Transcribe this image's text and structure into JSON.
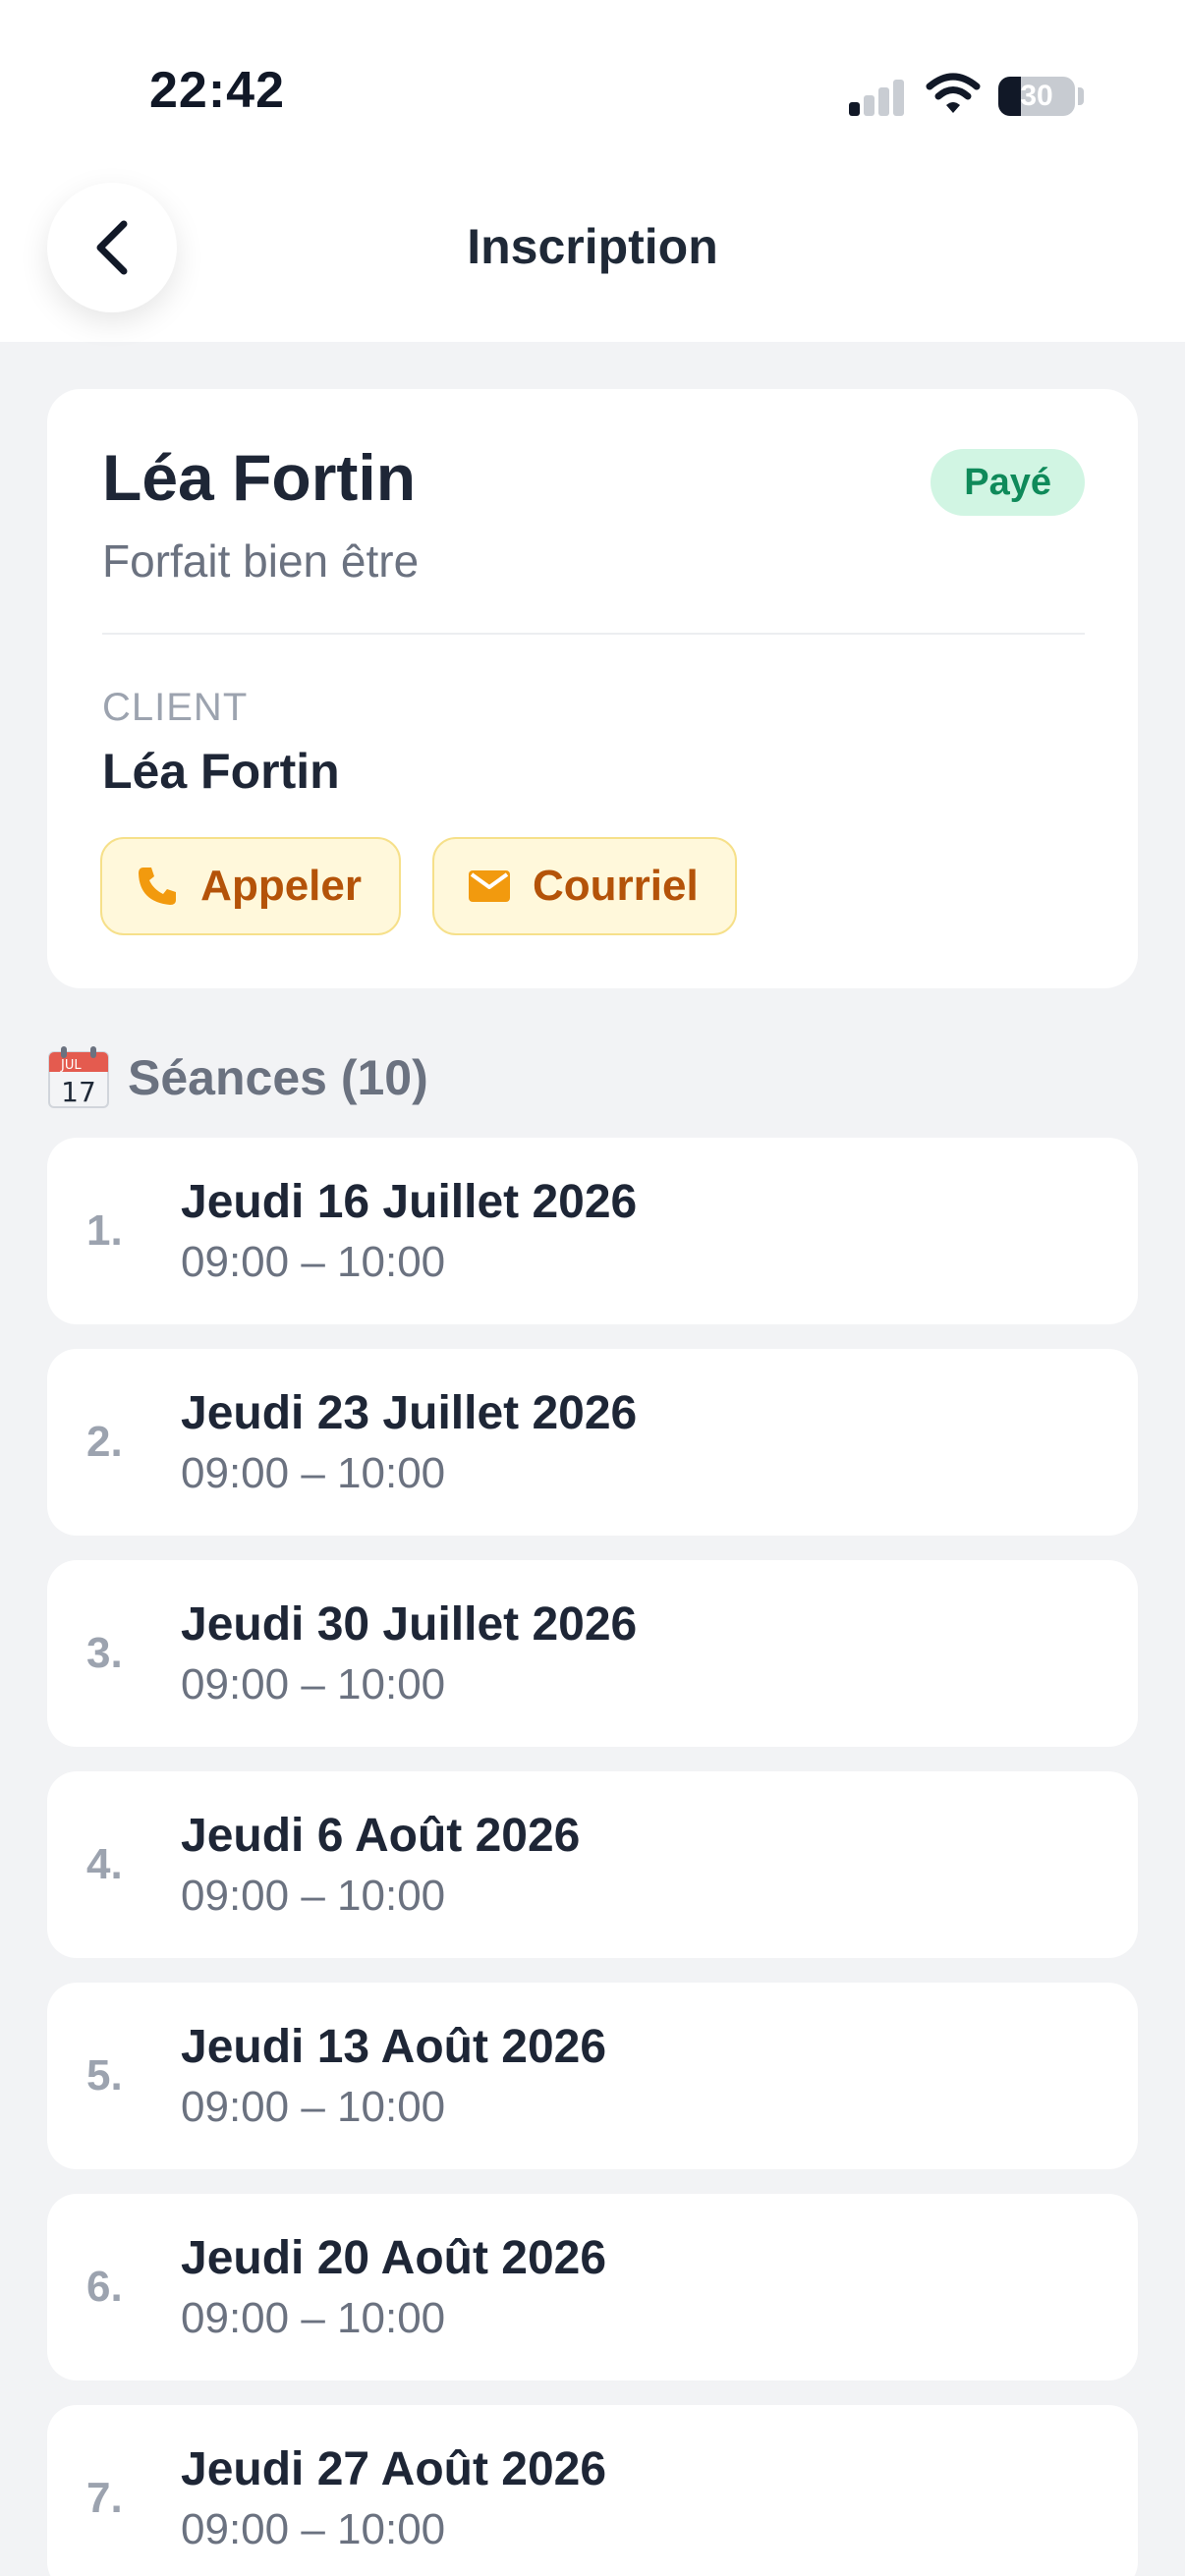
{
  "status_bar": {
    "time": "22:42",
    "battery_percent": 30,
    "battery_text": "30"
  },
  "header": {
    "title": "Inscription",
    "back_icon": "chevron-left-icon"
  },
  "summary": {
    "client_name": "Léa Fortin",
    "status": "Payé",
    "status_color": "#0f8a5a",
    "package": "Forfait bien être",
    "client_section_label": "CLIENT",
    "client_name_detail": "Léa Fortin",
    "call_label": "Appeler",
    "email_label": "Courriel",
    "accent_color": "#b45309"
  },
  "sessions": {
    "title": "Séances (10)",
    "icon": "calendar-icon",
    "calendar_month": "JUL",
    "calendar_day": "17",
    "items": [
      {
        "num": "1.",
        "date": "Jeudi 16 Juillet 2026",
        "time": "09:00 – 10:00"
      },
      {
        "num": "2.",
        "date": "Jeudi 23 Juillet 2026",
        "time": "09:00 – 10:00"
      },
      {
        "num": "3.",
        "date": "Jeudi 30 Juillet 2026",
        "time": "09:00 – 10:00"
      },
      {
        "num": "4.",
        "date": "Jeudi 6 Août 2026",
        "time": "09:00 – 10:00"
      },
      {
        "num": "5.",
        "date": "Jeudi 13 Août 2026",
        "time": "09:00 – 10:00"
      },
      {
        "num": "6.",
        "date": "Jeudi 20 Août 2026",
        "time": "09:00 – 10:00"
      },
      {
        "num": "7.",
        "date": "Jeudi 27 Août 2026",
        "time": "09:00 – 10:00"
      }
    ]
  }
}
